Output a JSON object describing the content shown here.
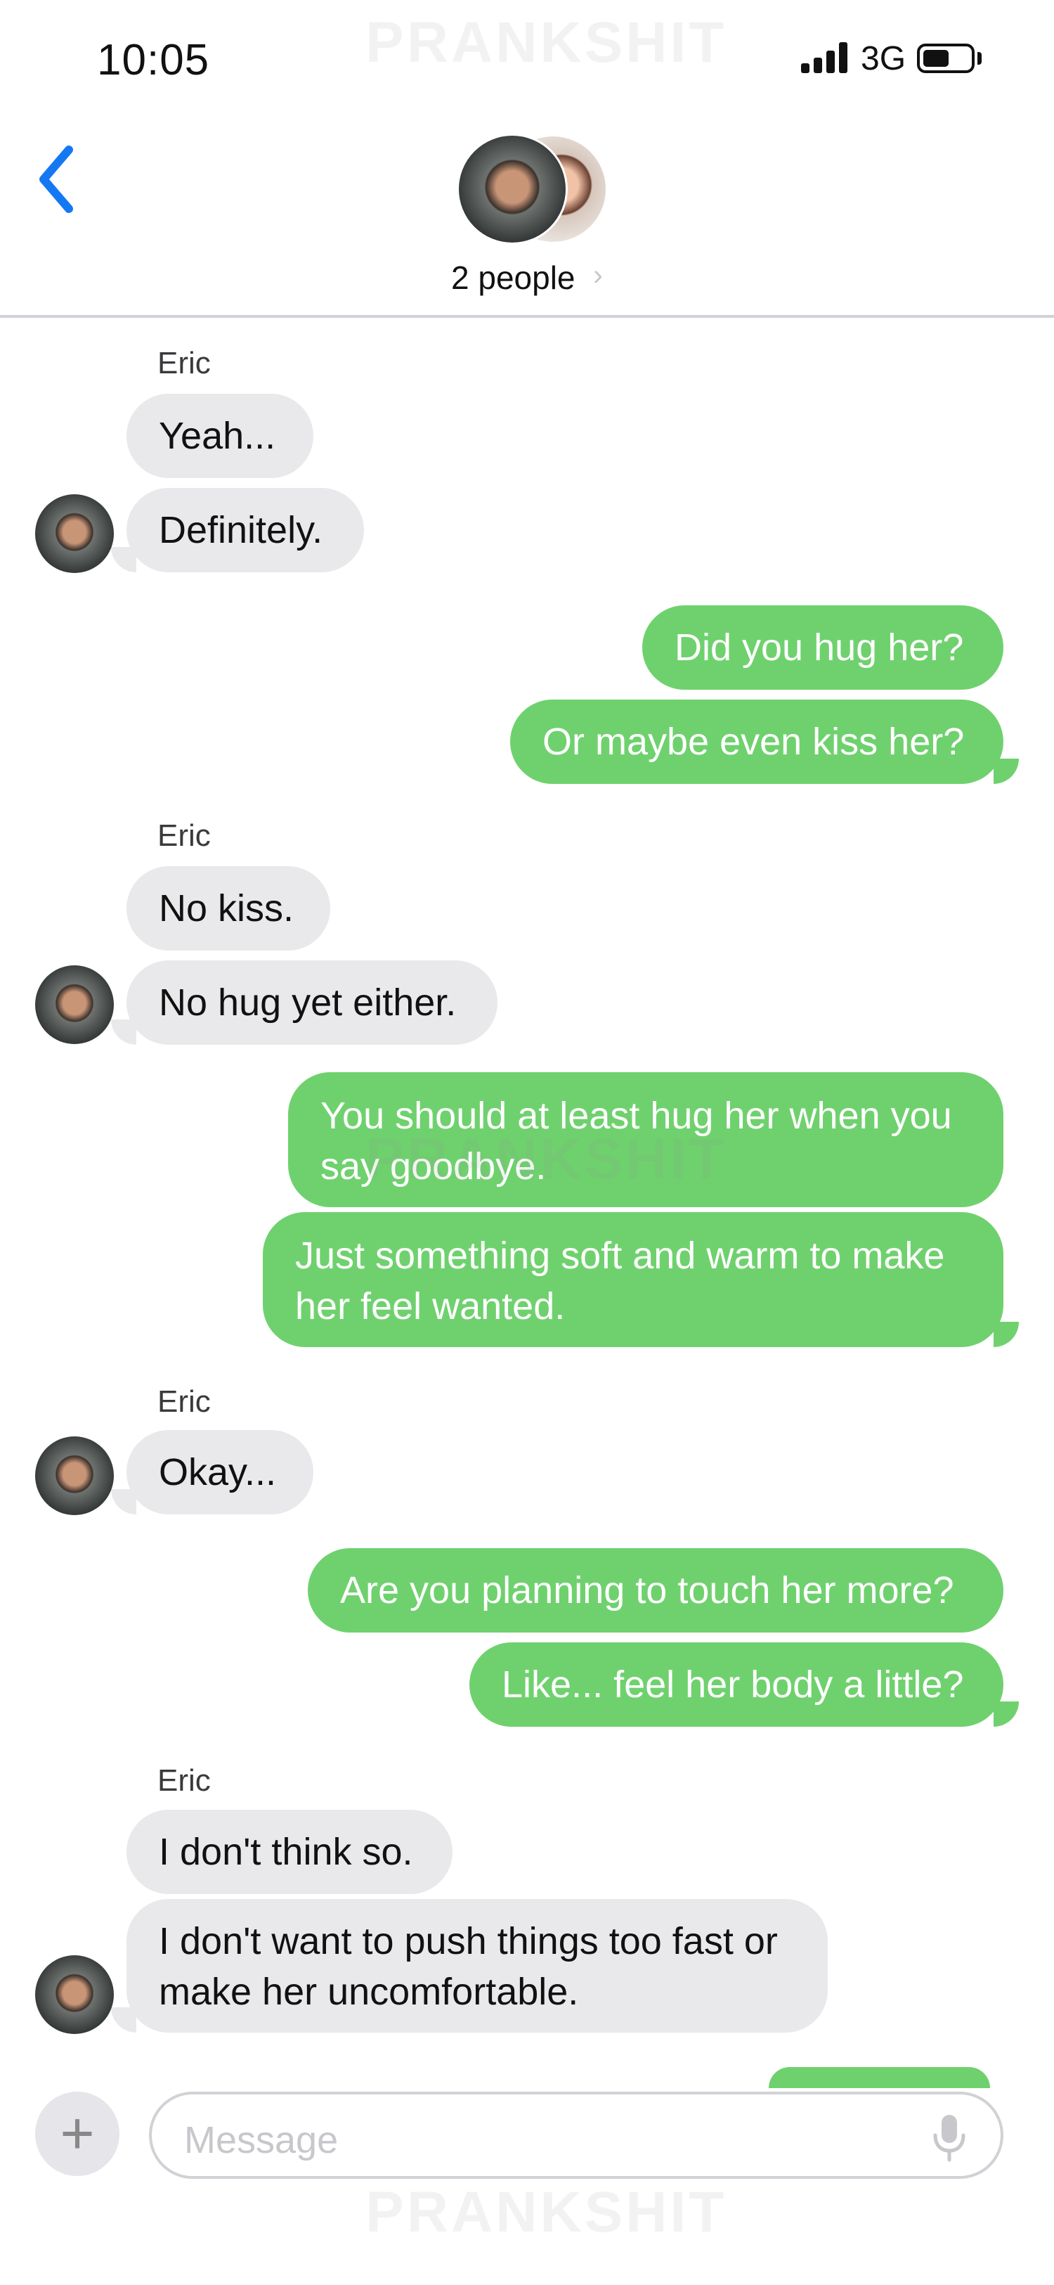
{
  "status": {
    "time": "10:05",
    "network": "3G"
  },
  "watermark": "PRANKSHIT",
  "header": {
    "people_label": "2 people"
  },
  "messages": [
    {
      "sender": "Eric",
      "text": [
        "Yeah...",
        "Definitely."
      ]
    },
    {
      "outgoing": [
        "Did you hug her?",
        "Or maybe even kiss her?"
      ]
    },
    {
      "sender": "Eric",
      "text": [
        "No kiss.",
        "No hug yet either."
      ]
    },
    {
      "outgoing": [
        "You should at least hug her when you say goodbye.",
        "Just something soft and warm to make her feel wanted."
      ]
    },
    {
      "sender": "Eric",
      "text": [
        "Okay..."
      ]
    },
    {
      "outgoing": [
        "Are you planning to touch her more?",
        "Like... feel her body a little?"
      ]
    },
    {
      "sender": "Eric",
      "text": [
        "I don't think so.",
        "I don't want to push things too fast or make her uncomfortable."
      ]
    }
  ],
  "composer": {
    "placeholder": "Message"
  },
  "icons": [
    "back-chevron-icon",
    "signal-icon",
    "battery-icon",
    "plus-icon",
    "microphone-icon"
  ],
  "colors": {
    "outgoing_bubble": "#6fd16e",
    "incoming_bubble": "#e9e9eb",
    "accent": "#1478f3"
  }
}
